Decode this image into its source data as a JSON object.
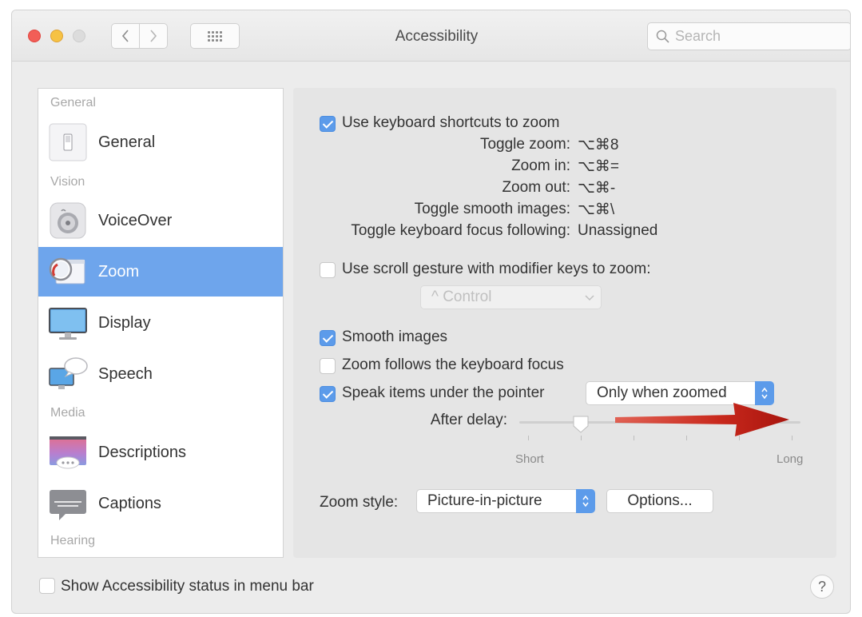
{
  "window": {
    "title": "Accessibility",
    "search_placeholder": "Search"
  },
  "sidebar": {
    "headings": [
      "General",
      "Vision",
      "Media",
      "Hearing"
    ],
    "items": [
      {
        "label": "General",
        "icon": "switch-icon",
        "selected": false
      },
      {
        "label": "VoiceOver",
        "icon": "voiceover-icon",
        "selected": false
      },
      {
        "label": "Zoom",
        "icon": "zoom-magnifier-icon",
        "selected": true
      },
      {
        "label": "Display",
        "icon": "monitor-icon",
        "selected": false
      },
      {
        "label": "Speech",
        "icon": "speech-bubble-icon",
        "selected": false
      },
      {
        "label": "Descriptions",
        "icon": "descriptions-icon",
        "selected": false
      },
      {
        "label": "Captions",
        "icon": "captions-icon",
        "selected": false
      }
    ]
  },
  "zoom": {
    "keyboard_shortcuts": {
      "label": "Use keyboard shortcuts to zoom",
      "checked": true
    },
    "shortcuts": [
      {
        "label": "Toggle zoom:",
        "value": "⌥⌘8"
      },
      {
        "label": "Zoom in:",
        "value": "⌥⌘="
      },
      {
        "label": "Zoom out:",
        "value": "⌥⌘-"
      },
      {
        "label": "Toggle smooth images:",
        "value": "⌥⌘\\"
      },
      {
        "label": "Toggle keyboard focus following:",
        "value": "Unassigned"
      }
    ],
    "scroll_gesture": {
      "label": "Use scroll gesture with modifier keys to zoom:",
      "checked": false,
      "modifier": "^ Control"
    },
    "smooth_images": {
      "label": "Smooth images",
      "checked": true
    },
    "follow_focus": {
      "label": "Zoom follows the keyboard focus",
      "checked": false
    },
    "speak_items": {
      "label": "Speak items under the pointer",
      "checked": true,
      "mode": "Only when zoomed"
    },
    "delay": {
      "label": "After delay:",
      "min_label": "Short",
      "max_label": "Long",
      "value": 0.22
    },
    "zoom_style": {
      "label": "Zoom style:",
      "value": "Picture-in-picture",
      "options_button": "Options..."
    }
  },
  "footer": {
    "status_menu": {
      "label": "Show Accessibility status in menu bar",
      "checked": false
    },
    "help": "?"
  },
  "colors": {
    "accent": "#5c9bea",
    "selection": "#6ea5ec",
    "arrow": "#c8281c"
  }
}
